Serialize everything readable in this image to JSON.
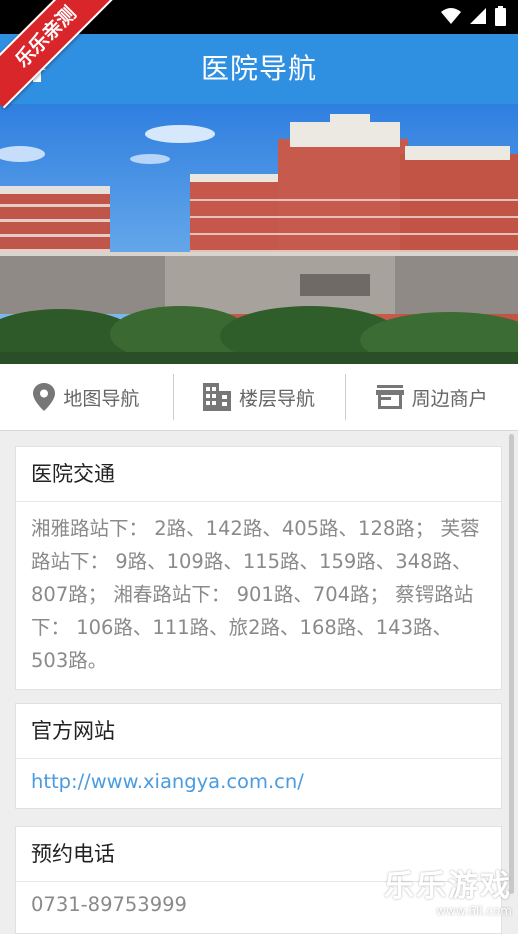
{
  "ribbon": {
    "label": "乐乐亲测"
  },
  "header": {
    "title": "医院导航",
    "home_icon": "home-icon"
  },
  "tabs": [
    {
      "label": "地图导航",
      "icon": "map-pin-icon"
    },
    {
      "label": "楼层导航",
      "icon": "building-icon"
    },
    {
      "label": "周边商户",
      "icon": "storefront-icon"
    }
  ],
  "cards": {
    "traffic": {
      "title": "医院交通",
      "body": "湘雅路站下： 2路、142路、405路、128路； 芙蓉路站下： 9路、109路、115路、159路、348路、807路； 湘春路站下： 901路、704路； 蔡锷路站下： 106路、111路、旅2路、168路、143路、503路。"
    },
    "website": {
      "title": "官方网站",
      "url": "http://www.xiangya.com.cn/"
    },
    "phone": {
      "title": "预约电话",
      "number": "0731-89753999"
    }
  },
  "watermark": {
    "big": "乐乐游戏",
    "small": "www.6ll.com"
  },
  "colors": {
    "appbar": "#2f8fe0",
    "ribbon": "#d9262b",
    "link": "#4a9be0"
  }
}
